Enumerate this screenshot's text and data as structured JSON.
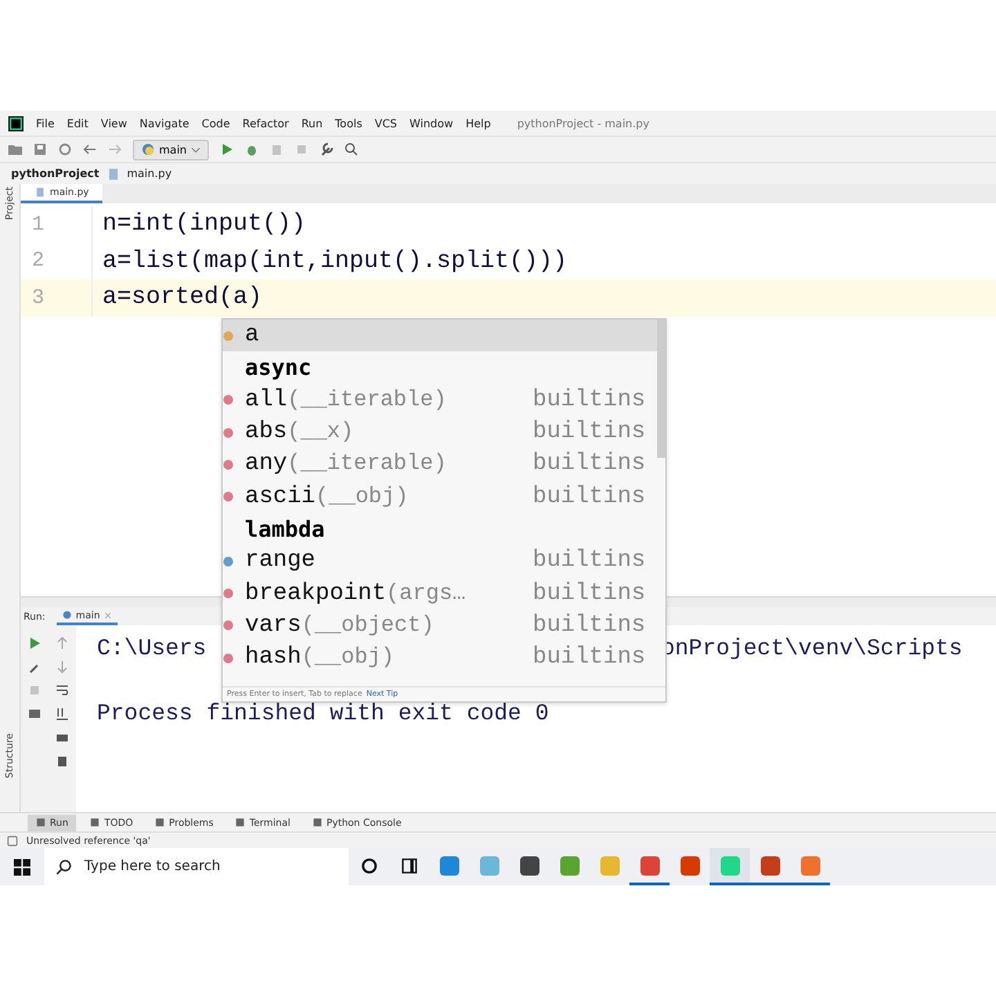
{
  "menu_bar": {
    "items": [
      "File",
      "Edit",
      "View",
      "Navigate",
      "Code",
      "Refactor",
      "Run",
      "Tools",
      "VCS",
      "Window",
      "Help"
    ],
    "title": "pythonProject - main.py"
  },
  "toolbar": {
    "run_config": "main"
  },
  "breadcrumb": [
    "pythonProject",
    "main.py"
  ],
  "side_tabs": {
    "top": "Project",
    "bottom": "Structure"
  },
  "editor_tabs": [
    {
      "label": "main.py",
      "selected": true
    }
  ],
  "editor": {
    "lines": [
      {
        "number": "1",
        "text": "n=int(input())",
        "current": false
      },
      {
        "number": "2",
        "text": "a=list(map(int,input().split()))",
        "current": false
      },
      {
        "number": "3",
        "text": "a=sorted(a)",
        "current": true
      }
    ]
  },
  "completion_popup": {
    "items": [
      {
        "kind": "variable",
        "name": "a",
        "selected": true
      },
      {
        "kind": "keyword",
        "name": "async",
        "selected": false
      },
      {
        "kind": "function",
        "name": "all",
        "params": "(__iterable)",
        "source": "builtins",
        "selected": false
      },
      {
        "kind": "function",
        "name": "abs",
        "params": "(__x)",
        "source": "builtins",
        "selected": false
      },
      {
        "kind": "function",
        "name": "any",
        "params": "(__iterable)",
        "source": "builtins",
        "selected": false
      },
      {
        "kind": "function",
        "name": "ascii",
        "params": "(__obj)",
        "source": "builtins",
        "selected": false
      },
      {
        "kind": "keyword",
        "name": "lambda",
        "selected": false
      },
      {
        "kind": "class",
        "name": "range",
        "source": "builtins",
        "selected": false
      },
      {
        "kind": "function",
        "name": "breakpoint",
        "params": "(args…",
        "source": "builtins",
        "selected": false
      },
      {
        "kind": "function",
        "name": "vars",
        "params": "(__object)",
        "source": "builtins",
        "selected": false
      },
      {
        "kind": "function",
        "name": "hash",
        "params": "(__obj)",
        "source": "builtins",
        "selected": false
      }
    ],
    "hint": "Press Enter to insert, Tab to replace",
    "hint_link": "Next Tip"
  },
  "run_panel": {
    "label": "Run:",
    "tabs": [
      {
        "label": "main",
        "selected": true
      }
    ],
    "output": [
      {
        "text": "C:\\Users",
        "rest": "onProject\\venv\\Scripts"
      },
      {
        "text": "Process finished with exit code 0"
      }
    ]
  },
  "tool_window_tabs": [
    {
      "label": "Run",
      "selected": true
    },
    {
      "label": "TODO",
      "selected": false
    },
    {
      "label": "Problems",
      "selected": false
    },
    {
      "label": "Terminal",
      "selected": false
    },
    {
      "label": "Python Console",
      "selected": false
    }
  ],
  "status_bar": {
    "message": "Unresolved reference 'qa'"
  },
  "taskbar": {
    "search": {
      "placeholder": "Type here to search"
    },
    "apps": [
      {
        "color": "#1e88d8",
        "running": false,
        "active": false
      },
      {
        "color": "#6ab7d9",
        "running": false,
        "active": false
      },
      {
        "color": "#444444",
        "running": false,
        "active": false
      },
      {
        "color": "#58a630",
        "running": false,
        "active": false
      },
      {
        "color": "#e8b730",
        "running": false,
        "active": false
      },
      {
        "color": "#db4437",
        "running": true,
        "active": false
      },
      {
        "color": "#d83b01",
        "running": false,
        "active": false
      },
      {
        "color": "#21d789",
        "running": true,
        "active": true
      },
      {
        "color": "#c43e1c",
        "running": true,
        "active": false
      },
      {
        "color": "#f07030",
        "running": true,
        "active": false
      }
    ]
  }
}
